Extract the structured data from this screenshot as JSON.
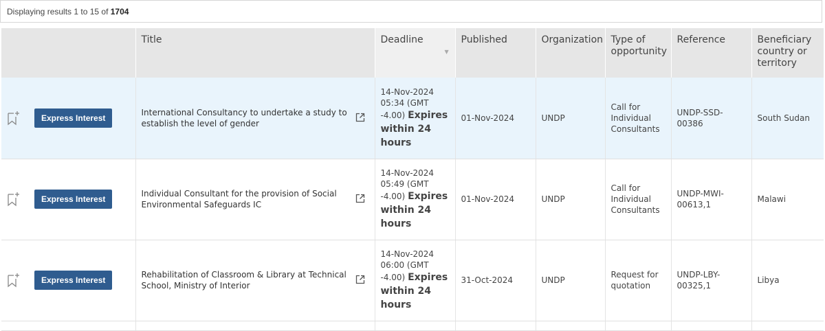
{
  "results": {
    "prefix": "Displaying results 1 to 15 of ",
    "total": "1704"
  },
  "columns": {
    "title": "Title",
    "deadline": "Deadline",
    "published": "Published",
    "organization": "Organization",
    "type_l1": "Type of",
    "type_l2": "opportunity",
    "reference": "Reference",
    "country_l1": "Beneficiary",
    "country_l2": "country or",
    "country_l3": "territory"
  },
  "express_label": "Express Interest",
  "rows": [
    {
      "title_l1": "International Consultancy to undertake a study to",
      "title_l2": "establish the level of gender",
      "deadline_date": "14-Nov-2024",
      "deadline_time": "05:34 (GMT",
      "deadline_tz": "-4.00)",
      "expires_l1": "Expires",
      "expires_l2": "within 24",
      "expires_l3": "hours",
      "published": "01-Nov-2024",
      "organization": "UNDP",
      "type_l1": "Call for",
      "type_l2": "Individual",
      "type_l3": "Consultants",
      "reference_l1": "UNDP-SSD-",
      "reference_l2": "00386",
      "country": "South Sudan"
    },
    {
      "title_l1": "Individual Consultant for the provision of Social",
      "title_l2": "Environmental Safeguards IC",
      "deadline_date": "14-Nov-2024",
      "deadline_time": "05:49 (GMT",
      "deadline_tz": "-4.00)",
      "expires_l1": "Expires",
      "expires_l2": "within 24",
      "expires_l3": "hours",
      "published": "01-Nov-2024",
      "organization": "UNDP",
      "type_l1": "Call for",
      "type_l2": "Individual",
      "type_l3": "Consultants",
      "reference_l1": "UNDP-MWI-",
      "reference_l2": "00613,1",
      "country": "Malawi"
    },
    {
      "title_l1": "Rehabilitation of Classroom & Library at Technical",
      "title_l2": "School, Ministry of Interior",
      "deadline_date": "14-Nov-2024",
      "deadline_time": "06:00 (GMT",
      "deadline_tz": "-4.00)",
      "expires_l1": "Expires",
      "expires_l2": "within 24",
      "expires_l3": "hours",
      "published": "31-Oct-2024",
      "organization": "UNDP",
      "type_l1": "Request for",
      "type_l2": "quotation",
      "type_l3": "",
      "reference_l1": "UNDP-LBY-",
      "reference_l2": "00325,1",
      "country": "Libya"
    }
  ],
  "icons": {
    "bookmark": "bookmark-add-icon",
    "external": "external-link-icon",
    "sort": "sort-caret-icon"
  },
  "colors": {
    "button": "#2f5c8f",
    "highlight_row": "#e9f4fc",
    "header_bg": "#e6e6e6"
  }
}
